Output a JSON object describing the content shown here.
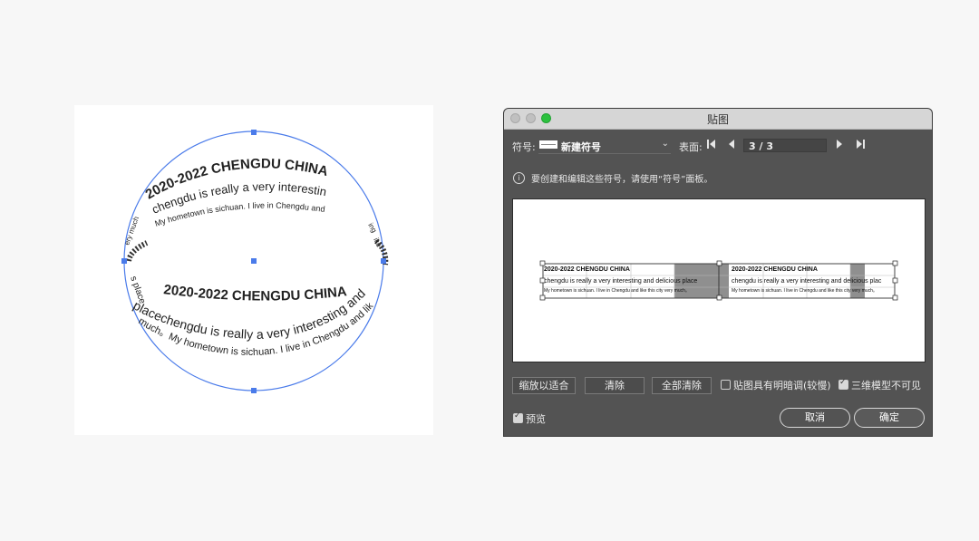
{
  "artboard": {
    "outer_top_lines": [
      "2020-2022 CHENGDU CHINA",
      "chengdu is really a very interesting and",
      "My hometown is sichuan. I live in Chengdu and"
    ],
    "front_lines": [
      "2020-2022 CHENGDU CHINA",
      "placechengdu is really a very interesting and",
      "much。My hometown is sichuan. I live in Chengdu and like"
    ],
    "side_fragments": [
      "s place",
      "ery much",
      "ing",
      "ike"
    ]
  },
  "dialog": {
    "title": "贴图",
    "symbol_label": "符号:",
    "symbol_name": "新建符号",
    "surface_label": "表面:",
    "page_value": "3 / 3",
    "info_text": "要创建和编辑这些符号，请使用“符号”面板。",
    "preview": {
      "left_lines": [
        "2020-2022 CHENGDU CHINA",
        "chengdu is really a very interesting and delicious place",
        "My hometown is sichuan. I live in Chengdu and like this city very much。"
      ],
      "right_lines": [
        "2020-2022 CHENGDU CHINA",
        "chengdu is really a very interesting and delicious plac",
        "My hometown is sichuan. I live in Chengdu and like this city very much。"
      ]
    },
    "buttons": {
      "fit": "缩放以适合",
      "clear": "清除",
      "clear_all": "全部清除",
      "cancel": "取消",
      "ok": "确定"
    },
    "options": {
      "shade_label": "贴图具有明暗调(较慢)",
      "shade_checked": false,
      "invisible_label": "三维模型不可见",
      "invisible_checked": true,
      "preview_label": "预览",
      "preview_checked": true
    }
  },
  "colors": {
    "selection_blue": "#4a7bea",
    "dialog_bg": "#535353",
    "green_light": "#2cc13f"
  }
}
